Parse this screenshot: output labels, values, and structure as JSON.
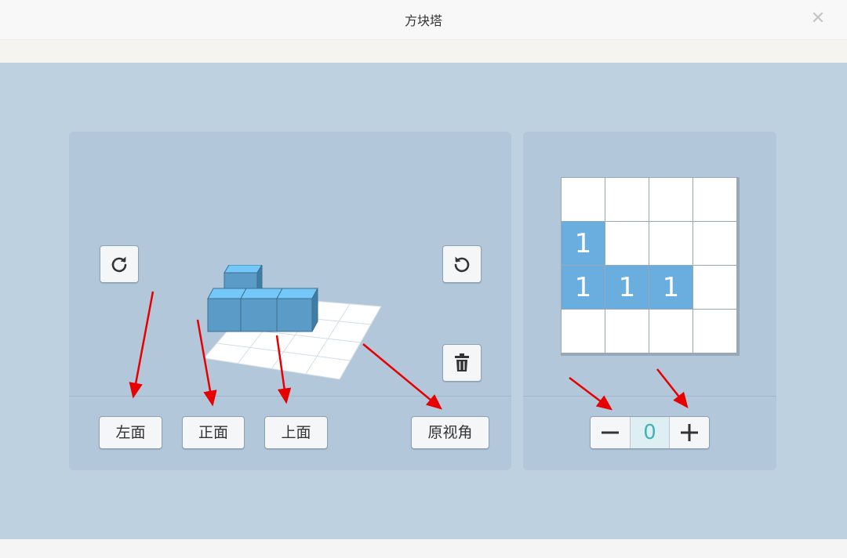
{
  "window": {
    "title": "方块塔",
    "close_symbol": "✕"
  },
  "view_controls": {
    "rotate_clockwise_icon": "rotate-clockwise",
    "rotate_counterclockwise_icon": "rotate-counterclockwise",
    "delete_icon": "trash",
    "left_label": "左面",
    "front_label": "正面",
    "top_label": "上面",
    "reset_label": "原视角"
  },
  "grid_editor": {
    "rows": [
      [
        "",
        "",
        "",
        ""
      ],
      [
        "1",
        "",
        "",
        ""
      ],
      [
        "1",
        "1",
        "1",
        ""
      ],
      [
        "",
        "",
        "",
        ""
      ]
    ],
    "filled_color": "#6aaee0",
    "empty_color": "#ffffff"
  },
  "stepper": {
    "minus_label": "−",
    "value": "0",
    "plus_label": "+"
  },
  "colors": {
    "workspace": "#bed1e0",
    "panel": "#b2c8da",
    "annotation_arrow": "#e60000",
    "cube_top": "#74c8f8",
    "cube_front": "#5a9bc7",
    "cube_side": "#3f7ca6"
  }
}
